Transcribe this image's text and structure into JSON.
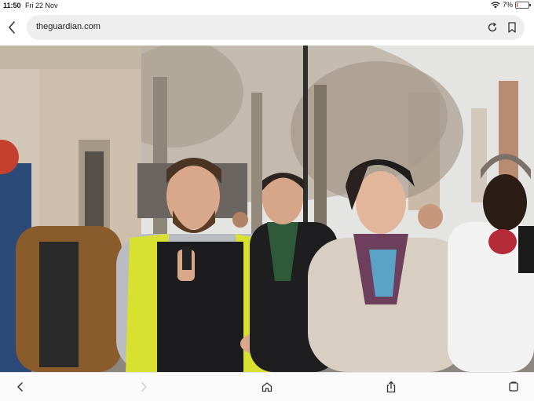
{
  "status": {
    "time": "11:50",
    "date": "Fri 22 Nov",
    "battery": "7%",
    "battery_level": 0.07
  },
  "browser": {
    "url": "theguardian.com"
  },
  "toolbar": {
    "icons": [
      "back-icon",
      "forward-icon",
      "home-icon",
      "share-icon",
      "tabs-icon"
    ]
  },
  "colors": {
    "url_field_bg": "#eeeeef",
    "battery_low": "#e03a2f",
    "hi_vis_yellow": "#d8e030"
  }
}
